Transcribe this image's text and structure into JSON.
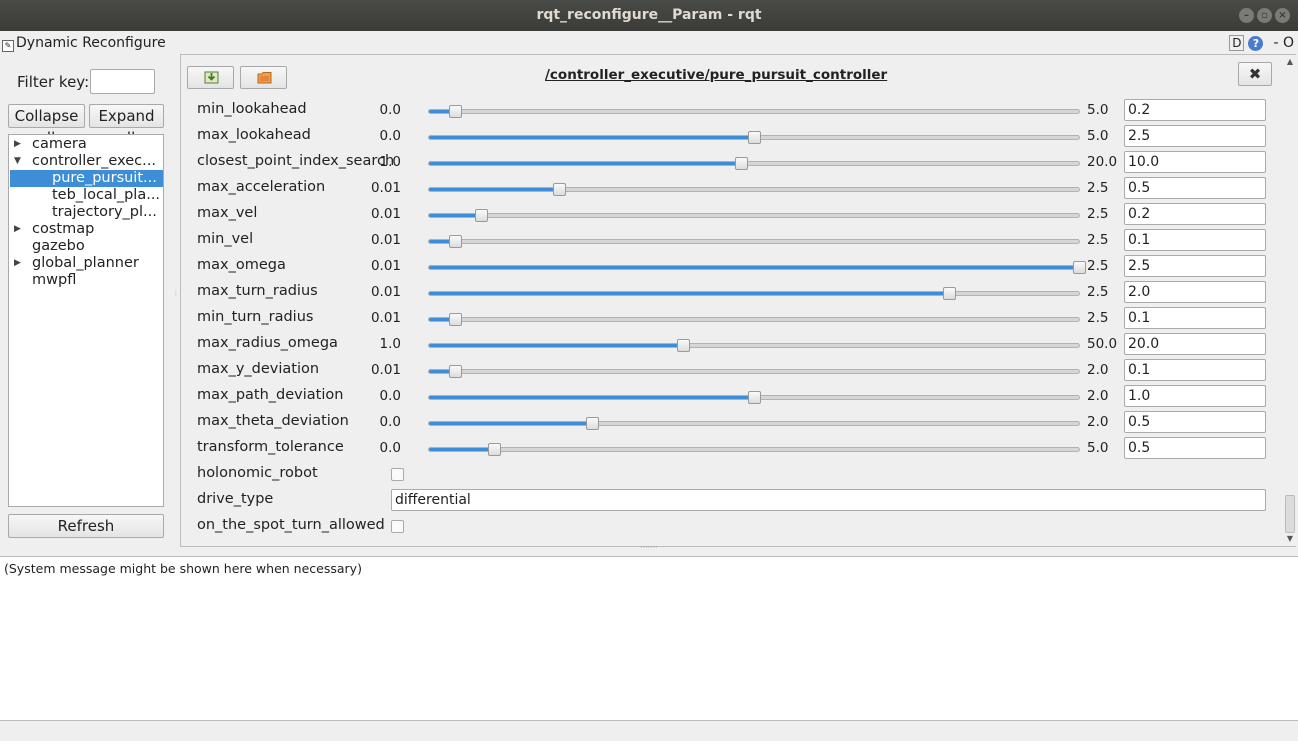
{
  "window": {
    "title": "rqt_reconfigure__Param - rqt",
    "buttons": [
      "–",
      "▫",
      "×"
    ]
  },
  "plugin": {
    "title": "Dynamic Reconfigure",
    "d_label": "D",
    "help_label": "?",
    "extra": "- O"
  },
  "filter": {
    "label": "Filter key:",
    "value": ""
  },
  "buttons": {
    "collapse_all": "Collapse all",
    "expand_all": "Expand all",
    "refresh": "Refresh"
  },
  "tree": [
    {
      "label": "camera",
      "arrow": "right"
    },
    {
      "label": "controller_exec...",
      "arrow": "down"
    },
    {
      "label": "pure_pursuit...",
      "arrow": "",
      "child": true,
      "selected": true
    },
    {
      "label": "teb_local_pla...",
      "arrow": "",
      "child": true
    },
    {
      "label": "trajectory_pl...",
      "arrow": "",
      "child": true
    },
    {
      "label": "costmap",
      "arrow": "right"
    },
    {
      "label": "gazebo",
      "arrow": ""
    },
    {
      "label": "global_planner",
      "arrow": "right"
    },
    {
      "label": "mwpfl",
      "arrow": ""
    }
  ],
  "node": {
    "title": "/controller_executive/pure_pursuit_controller",
    "close_icon": "✖"
  },
  "params": [
    {
      "name": "min_lookahead",
      "min": "0.0",
      "max": "5.0",
      "value": "0.2",
      "fraction": 0.04
    },
    {
      "name": "max_lookahead",
      "min": "0.0",
      "max": "5.0",
      "value": "2.5",
      "fraction": 0.5
    },
    {
      "name": "closest_point_index_search",
      "min": "1.0",
      "max": "20.0",
      "value": "10.0",
      "fraction": 0.48
    },
    {
      "name": "max_acceleration",
      "min": "0.01",
      "max": "2.5",
      "value": "0.5",
      "fraction": 0.2
    },
    {
      "name": "max_vel",
      "min": "0.01",
      "max": "2.5",
      "value": "0.2",
      "fraction": 0.08
    },
    {
      "name": "min_vel",
      "min": "0.01",
      "max": "2.5",
      "value": "0.1",
      "fraction": 0.04
    },
    {
      "name": "max_omega",
      "min": "0.01",
      "max": "2.5",
      "value": "2.5",
      "fraction": 1.0
    },
    {
      "name": "max_turn_radius",
      "min": "0.01",
      "max": "2.5",
      "value": "2.0",
      "fraction": 0.8
    },
    {
      "name": "min_turn_radius",
      "min": "0.01",
      "max": "2.5",
      "value": "0.1",
      "fraction": 0.04
    },
    {
      "name": "max_radius_omega",
      "min": "1.0",
      "max": "50.0",
      "value": "20.0",
      "fraction": 0.39
    },
    {
      "name": "max_y_deviation",
      "min": "0.01",
      "max": "2.0",
      "value": "0.1",
      "fraction": 0.04
    },
    {
      "name": "max_path_deviation",
      "min": "0.0",
      "max": "2.0",
      "value": "1.0",
      "fraction": 0.5
    },
    {
      "name": "max_theta_deviation",
      "min": "0.0",
      "max": "2.0",
      "value": "0.5",
      "fraction": 0.25
    },
    {
      "name": "transform_tolerance",
      "min": "0.0",
      "max": "5.0",
      "value": "0.5",
      "fraction": 0.1
    }
  ],
  "bool_params": [
    {
      "name": "holonomic_robot",
      "checked": false
    },
    {
      "name": "on_the_spot_turn_allowed",
      "checked": false
    }
  ],
  "drive_type": {
    "name": "drive_type",
    "value": "differential"
  },
  "message": "(System message might be shown here when necessary)",
  "colors": {
    "accent": "#3d8ed7",
    "titlebar": "#3b3b38"
  }
}
